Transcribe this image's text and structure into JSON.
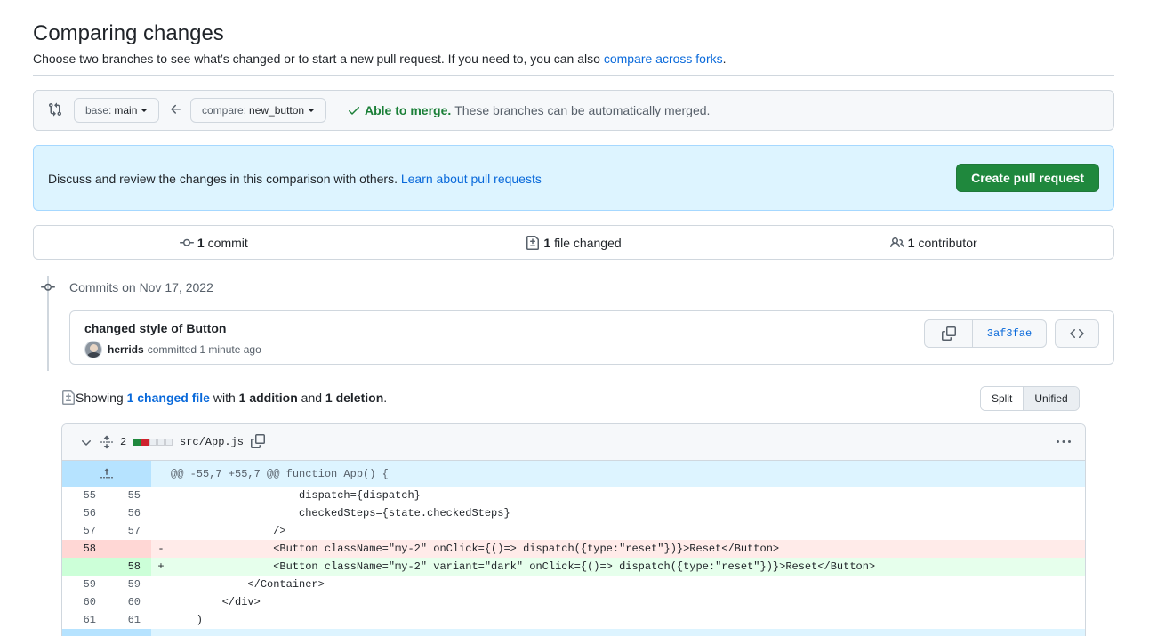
{
  "header": {
    "title": "Comparing changes",
    "subtitle": "Choose two branches to see what’s changed or to start a new pull request. If you need to, you can also ",
    "subtitle_link": "compare across forks",
    "subtitle_end": "."
  },
  "range": {
    "base_label": "base:",
    "base_value": "main",
    "compare_label": "compare:",
    "compare_value": "new_button",
    "merge_status": "Able to merge.",
    "merge_desc": "These branches can be automatically merged."
  },
  "discuss": {
    "text": "Discuss and review the changes in this comparison with others. ",
    "link": "Learn about pull requests",
    "create_button": "Create pull request"
  },
  "summary": {
    "commits_count": "1",
    "commits_label": "commit",
    "files_count": "1",
    "files_label": "file changed",
    "contributors_count": "1",
    "contributors_label": "contributor"
  },
  "commits": {
    "date_heading": "Commits on Nov 17, 2022",
    "message": "changed style of Button",
    "author": "herrids",
    "committed": "committed 1 minute ago",
    "sha": "3af3fae"
  },
  "diff_summary": {
    "showing": "Showing ",
    "changed_link": "1 changed file",
    "with": " with ",
    "additions": "1 addition",
    "and": " and ",
    "deletions": "1 deletion",
    "end": ".",
    "view_split": "Split",
    "view_unified": "Unified"
  },
  "file": {
    "change_count": "2",
    "path": "src/App.js",
    "hunk_header": "@@ -55,7 +55,7 @@ function App() {",
    "lines": [
      {
        "old": "55",
        "new": "55",
        "type": "ctx",
        "code": "                    dispatch={dispatch}"
      },
      {
        "old": "56",
        "new": "56",
        "type": "ctx",
        "code": "                    checkedSteps={state.checkedSteps}"
      },
      {
        "old": "57",
        "new": "57",
        "type": "ctx",
        "code": "                />"
      },
      {
        "old": "58",
        "new": "",
        "type": "del",
        "code": "                <Button className=\"my-2\" onClick={()=> dispatch({type:\"reset\"})}>Reset</Button>"
      },
      {
        "old": "",
        "new": "58",
        "type": "add",
        "code": "                <Button className=\"my-2\" variant=\"dark\" onClick={()=> dispatch({type:\"reset\"})}>Reset</Button>"
      },
      {
        "old": "59",
        "new": "59",
        "type": "ctx",
        "code": "            </Container>"
      },
      {
        "old": "60",
        "new": "60",
        "type": "ctx",
        "code": "        </div>"
      },
      {
        "old": "61",
        "new": "61",
        "type": "ctx",
        "code": "    )"
      }
    ]
  },
  "colors": {
    "accent": "#0969da",
    "success": "#1a7f37",
    "primary_button": "#1f883d",
    "deletion": "#cf222e"
  }
}
